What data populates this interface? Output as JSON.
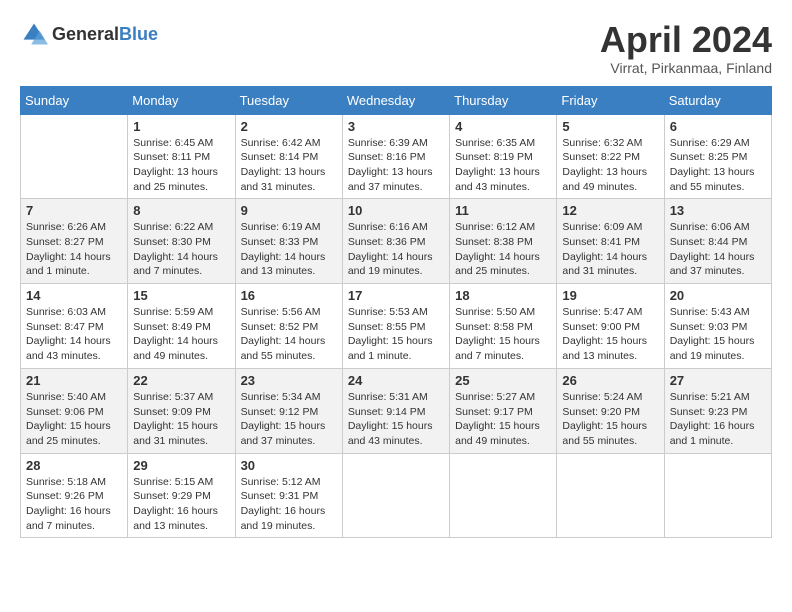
{
  "header": {
    "logo_general": "General",
    "logo_blue": "Blue",
    "title": "April 2024",
    "location": "Virrat, Pirkanmaa, Finland"
  },
  "days_of_week": [
    "Sunday",
    "Monday",
    "Tuesday",
    "Wednesday",
    "Thursday",
    "Friday",
    "Saturday"
  ],
  "weeks": [
    [
      {
        "date": "",
        "sunrise": "",
        "sunset": "",
        "daylight": ""
      },
      {
        "date": "1",
        "sunrise": "Sunrise: 6:45 AM",
        "sunset": "Sunset: 8:11 PM",
        "daylight": "Daylight: 13 hours and 25 minutes."
      },
      {
        "date": "2",
        "sunrise": "Sunrise: 6:42 AM",
        "sunset": "Sunset: 8:14 PM",
        "daylight": "Daylight: 13 hours and 31 minutes."
      },
      {
        "date": "3",
        "sunrise": "Sunrise: 6:39 AM",
        "sunset": "Sunset: 8:16 PM",
        "daylight": "Daylight: 13 hours and 37 minutes."
      },
      {
        "date": "4",
        "sunrise": "Sunrise: 6:35 AM",
        "sunset": "Sunset: 8:19 PM",
        "daylight": "Daylight: 13 hours and 43 minutes."
      },
      {
        "date": "5",
        "sunrise": "Sunrise: 6:32 AM",
        "sunset": "Sunset: 8:22 PM",
        "daylight": "Daylight: 13 hours and 49 minutes."
      },
      {
        "date": "6",
        "sunrise": "Sunrise: 6:29 AM",
        "sunset": "Sunset: 8:25 PM",
        "daylight": "Daylight: 13 hours and 55 minutes."
      }
    ],
    [
      {
        "date": "7",
        "sunrise": "Sunrise: 6:26 AM",
        "sunset": "Sunset: 8:27 PM",
        "daylight": "Daylight: 14 hours and 1 minute."
      },
      {
        "date": "8",
        "sunrise": "Sunrise: 6:22 AM",
        "sunset": "Sunset: 8:30 PM",
        "daylight": "Daylight: 14 hours and 7 minutes."
      },
      {
        "date": "9",
        "sunrise": "Sunrise: 6:19 AM",
        "sunset": "Sunset: 8:33 PM",
        "daylight": "Daylight: 14 hours and 13 minutes."
      },
      {
        "date": "10",
        "sunrise": "Sunrise: 6:16 AM",
        "sunset": "Sunset: 8:36 PM",
        "daylight": "Daylight: 14 hours and 19 minutes."
      },
      {
        "date": "11",
        "sunrise": "Sunrise: 6:12 AM",
        "sunset": "Sunset: 8:38 PM",
        "daylight": "Daylight: 14 hours and 25 minutes."
      },
      {
        "date": "12",
        "sunrise": "Sunrise: 6:09 AM",
        "sunset": "Sunset: 8:41 PM",
        "daylight": "Daylight: 14 hours and 31 minutes."
      },
      {
        "date": "13",
        "sunrise": "Sunrise: 6:06 AM",
        "sunset": "Sunset: 8:44 PM",
        "daylight": "Daylight: 14 hours and 37 minutes."
      }
    ],
    [
      {
        "date": "14",
        "sunrise": "Sunrise: 6:03 AM",
        "sunset": "Sunset: 8:47 PM",
        "daylight": "Daylight: 14 hours and 43 minutes."
      },
      {
        "date": "15",
        "sunrise": "Sunrise: 5:59 AM",
        "sunset": "Sunset: 8:49 PM",
        "daylight": "Daylight: 14 hours and 49 minutes."
      },
      {
        "date": "16",
        "sunrise": "Sunrise: 5:56 AM",
        "sunset": "Sunset: 8:52 PM",
        "daylight": "Daylight: 14 hours and 55 minutes."
      },
      {
        "date": "17",
        "sunrise": "Sunrise: 5:53 AM",
        "sunset": "Sunset: 8:55 PM",
        "daylight": "Daylight: 15 hours and 1 minute."
      },
      {
        "date": "18",
        "sunrise": "Sunrise: 5:50 AM",
        "sunset": "Sunset: 8:58 PM",
        "daylight": "Daylight: 15 hours and 7 minutes."
      },
      {
        "date": "19",
        "sunrise": "Sunrise: 5:47 AM",
        "sunset": "Sunset: 9:00 PM",
        "daylight": "Daylight: 15 hours and 13 minutes."
      },
      {
        "date": "20",
        "sunrise": "Sunrise: 5:43 AM",
        "sunset": "Sunset: 9:03 PM",
        "daylight": "Daylight: 15 hours and 19 minutes."
      }
    ],
    [
      {
        "date": "21",
        "sunrise": "Sunrise: 5:40 AM",
        "sunset": "Sunset: 9:06 PM",
        "daylight": "Daylight: 15 hours and 25 minutes."
      },
      {
        "date": "22",
        "sunrise": "Sunrise: 5:37 AM",
        "sunset": "Sunset: 9:09 PM",
        "daylight": "Daylight: 15 hours and 31 minutes."
      },
      {
        "date": "23",
        "sunrise": "Sunrise: 5:34 AM",
        "sunset": "Sunset: 9:12 PM",
        "daylight": "Daylight: 15 hours and 37 minutes."
      },
      {
        "date": "24",
        "sunrise": "Sunrise: 5:31 AM",
        "sunset": "Sunset: 9:14 PM",
        "daylight": "Daylight: 15 hours and 43 minutes."
      },
      {
        "date": "25",
        "sunrise": "Sunrise: 5:27 AM",
        "sunset": "Sunset: 9:17 PM",
        "daylight": "Daylight: 15 hours and 49 minutes."
      },
      {
        "date": "26",
        "sunrise": "Sunrise: 5:24 AM",
        "sunset": "Sunset: 9:20 PM",
        "daylight": "Daylight: 15 hours and 55 minutes."
      },
      {
        "date": "27",
        "sunrise": "Sunrise: 5:21 AM",
        "sunset": "Sunset: 9:23 PM",
        "daylight": "Daylight: 16 hours and 1 minute."
      }
    ],
    [
      {
        "date": "28",
        "sunrise": "Sunrise: 5:18 AM",
        "sunset": "Sunset: 9:26 PM",
        "daylight": "Daylight: 16 hours and 7 minutes."
      },
      {
        "date": "29",
        "sunrise": "Sunrise: 5:15 AM",
        "sunset": "Sunset: 9:29 PM",
        "daylight": "Daylight: 16 hours and 13 minutes."
      },
      {
        "date": "30",
        "sunrise": "Sunrise: 5:12 AM",
        "sunset": "Sunset: 9:31 PM",
        "daylight": "Daylight: 16 hours and 19 minutes."
      },
      {
        "date": "",
        "sunrise": "",
        "sunset": "",
        "daylight": ""
      },
      {
        "date": "",
        "sunrise": "",
        "sunset": "",
        "daylight": ""
      },
      {
        "date": "",
        "sunrise": "",
        "sunset": "",
        "daylight": ""
      },
      {
        "date": "",
        "sunrise": "",
        "sunset": "",
        "daylight": ""
      }
    ]
  ],
  "row_shading": [
    false,
    true,
    false,
    true,
    false
  ]
}
